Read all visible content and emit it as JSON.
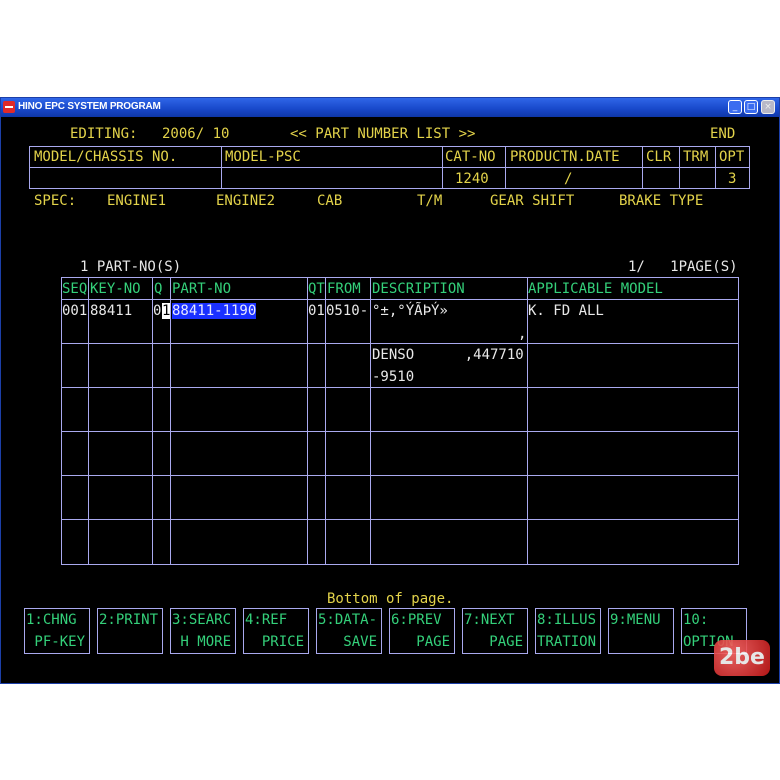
{
  "window": {
    "title": "HINO EPC SYSTEM PROGRAM",
    "minimize": "_",
    "maximize": "□",
    "close": "×"
  },
  "header": {
    "editing_label": "EDITING:",
    "editing_date": "2006/ 10",
    "screen_title": "<< PART NUMBER LIST >>",
    "end": "END"
  },
  "model_table": {
    "headers": [
      "MODEL/CHASSIS NO.",
      "MODEL-PSC",
      "CAT-NO",
      "PRODUCTN.DATE",
      "CLR",
      "TRM",
      "OPT"
    ],
    "values": [
      "",
      "",
      "1240",
      "/",
      "",
      "",
      "3"
    ]
  },
  "spec": {
    "label": "SPEC:",
    "items": [
      "ENGINE1",
      "ENGINE2",
      "CAB",
      "T/M",
      "GEAR SHIFT",
      "BRAKE TYPE"
    ]
  },
  "list_info": {
    "count_label": "1 PART-NO(S)",
    "page_info": "1/   1PAGE(S)"
  },
  "parts_table": {
    "headers": [
      "SEQ",
      "KEY-NO",
      "Q",
      "PART-NO",
      "QT",
      "FROM",
      "DESCRIPTION",
      "APPLICABLE MODEL"
    ],
    "row1": {
      "seq": "001",
      "key_no": "88411",
      "q": "0",
      "q2": "1",
      "part_no": "88411-1190",
      "qt": "01",
      "from": "0510-",
      "description": "°±,°ÝÃÞÝ»",
      "applicable_model": "K. FD ALL",
      "comma": ","
    },
    "row2": {
      "desc_line1": "DENSO      ,447710",
      "desc_line2": "-9510"
    }
  },
  "status": "Bottom of page.",
  "function_keys": [
    {
      "line1": "1:CHNG",
      "line2": " PF-KEY"
    },
    {
      "line1": "2:PRINT",
      "line2": ""
    },
    {
      "line1": "3:SEARC",
      "line2": " H MORE"
    },
    {
      "line1": "4:REF",
      "line2": "  PRICE"
    },
    {
      "line1": "5:DATA-",
      "line2": "   SAVE"
    },
    {
      "line1": "6:PREV",
      "line2": "   PAGE"
    },
    {
      "line1": "7:NEXT",
      "line2": "   PAGE"
    },
    {
      "line1": "8:ILLUS",
      "line2": "TRATION"
    },
    {
      "line1": "9:MENU",
      "line2": ""
    },
    {
      "line1": "10:",
      "line2": "OPTION"
    }
  ],
  "watermark": "2be"
}
